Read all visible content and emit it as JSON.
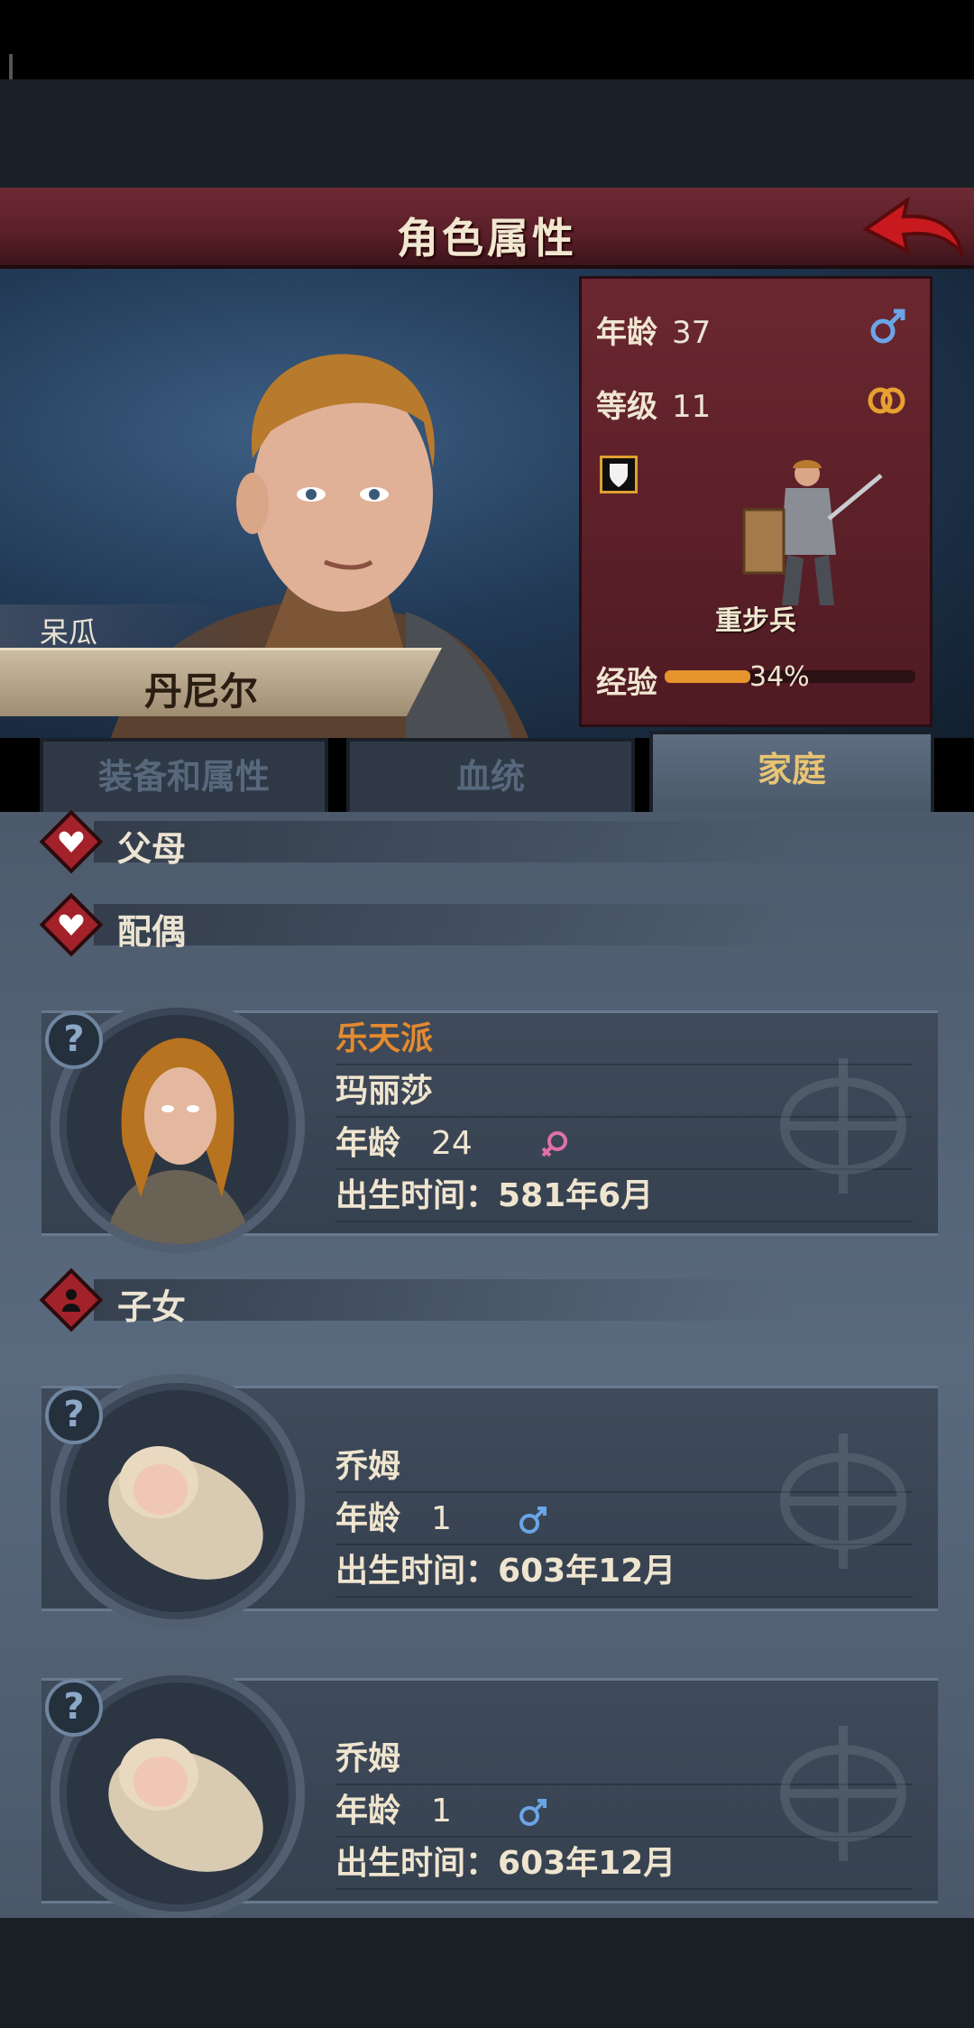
{
  "header": {
    "title": "角色属性"
  },
  "character": {
    "nickname": "呆瓜",
    "name": "丹尼尔",
    "age_label": "年龄",
    "age": "37",
    "level_label": "等级",
    "level": "11",
    "class_name": "重步兵",
    "exp_label": "经验",
    "exp_percent_text": "34%",
    "exp_fraction": 0.34
  },
  "tabs": [
    {
      "label": "装备和属性"
    },
    {
      "label": "血统"
    },
    {
      "label": "家庭"
    }
  ],
  "family": {
    "parents_label": "父母",
    "spouse_label": "配偶",
    "children_label": "子女",
    "spouse": {
      "nickname": "乐天派",
      "name": "玛丽莎",
      "age_label": "年龄",
      "age": "24",
      "birth_label": "出生时间：",
      "birth": "581年6月"
    },
    "children": [
      {
        "name": "乔姆",
        "age_label": "年龄",
        "age": "1",
        "birth_label": "出生时间：",
        "birth": "603年12月"
      },
      {
        "name": "乔姆",
        "age_label": "年龄",
        "age": "1",
        "birth_label": "出生时间：",
        "birth": "603年12月"
      }
    ]
  },
  "colors": {
    "accent_orange": "#e48a2f",
    "title_red": "#6e2a34",
    "male_blue": "#6aa6e6",
    "female_pink": "#e070a8"
  }
}
